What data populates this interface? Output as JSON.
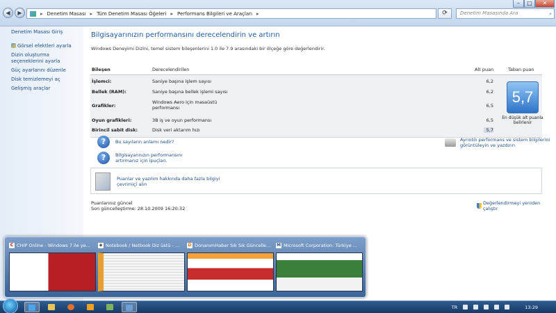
{
  "addressbar": {
    "breadcrumbs": [
      "Denetim Masası",
      "Tüm Denetim Masası Öğeleri",
      "Performans Bilgileri ve Araçları"
    ],
    "search_placeholder": "Denetim Masasında Ara"
  },
  "sidebar": {
    "home": "Denetim Masası Giriş",
    "items": [
      {
        "label": "Görsel efektleri ayarla"
      },
      {
        "label": "Dizin oluşturma seçeneklerini ayarla"
      },
      {
        "label": "Güç ayarlarını düzenle"
      },
      {
        "label": "Disk temizlemeyi aç"
      },
      {
        "label": "Gelişmiş araçlar"
      }
    ]
  },
  "main": {
    "title": "Bilgisayarınızın performansını derecelendirin ve artırın",
    "description": "Windows Deneyimi Dizini, temel sistem bileşenlerini 1.0 ile 7.9 arasındaki bir ölçeğe göre değerlendirir.",
    "headers": {
      "component": "Bileşen",
      "rated": "Derecelendirilen",
      "subscore": "Alt puan",
      "basescore": "Taban puan"
    },
    "rows": [
      {
        "component": "İşlemci:",
        "rated": "Saniye başına işlem sayısı",
        "score": "6,2"
      },
      {
        "component": "Bellek (RAM):",
        "rated": "Saniye başına bellek işlemi sayısı",
        "score": "6,2"
      },
      {
        "component": "Grafikler:",
        "rated": "Windows Aero için masaüstü performansı",
        "score": "6,5"
      },
      {
        "component": "Oyun grafikleri:",
        "rated": "3B iş ve oyun performansı",
        "score": "6,5"
      },
      {
        "component": "Birincil sabit disk:",
        "rated": "Disk veri aktarım hızı",
        "score": "5,7"
      }
    ],
    "base_score": "5,7",
    "base_caption": "En düşük alt puanla belirlenir",
    "help1": "Bu sayıların anlamı nedir?",
    "help2": "Bilgisayarınızın performansını artırmanız için ipuçları.",
    "print_link": "Ayrıntılı performans ve sistem bilgilerini görüntüleyin ve yazdırın",
    "info_link": "Puanlar ve yazılım hakkında daha fazla bilgiyi çevrimiçi alın",
    "status_line1": "Puanlarınız güncel",
    "status_line2": "Son güncelleştirme: 28.10.2009 16:20:32",
    "rerun": "Değerlendirmeyi yeniden çalıştır"
  },
  "thumbnails": [
    {
      "title": "CHIP Online - Windows 7 ile ye...",
      "icon": "chip-favicon"
    },
    {
      "title": "Notebook / Netbook Diz üstü - ...",
      "icon": "forum-favicon"
    },
    {
      "title": "DonanımHaber Sık Sık Güncelle...",
      "icon": "dh-favicon"
    },
    {
      "title": "Microsoft Corporation: Türkiye ...",
      "icon": "ms-favicon"
    }
  ],
  "taskbar": {
    "language": "TR",
    "clock": "13:29"
  },
  "colors": {
    "link": "#1c4e8c",
    "title": "#1e5aa0",
    "badge_top": "#8fc5f5",
    "badge_bottom": "#2f74c9"
  }
}
